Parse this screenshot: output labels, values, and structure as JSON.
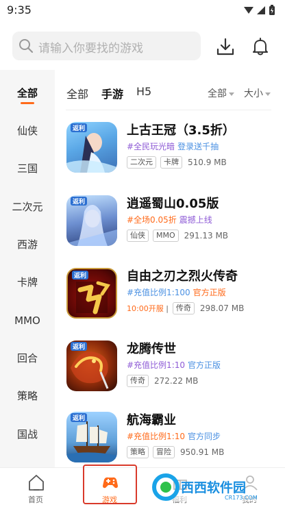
{
  "status_bar": {
    "time": "9:35"
  },
  "search": {
    "placeholder": "请输入你要找的游戏"
  },
  "sidebar": {
    "items": [
      {
        "label": "全部",
        "active": true
      },
      {
        "label": "仙侠"
      },
      {
        "label": "三国"
      },
      {
        "label": "二次元"
      },
      {
        "label": "西游"
      },
      {
        "label": "卡牌"
      },
      {
        "label": "MMO"
      },
      {
        "label": "回合"
      },
      {
        "label": "策略"
      },
      {
        "label": "国战"
      }
    ]
  },
  "tabs": {
    "items": [
      {
        "label": "全部"
      },
      {
        "label": "手游",
        "active": true
      },
      {
        "label": "H5"
      }
    ],
    "filter_all": "全部",
    "filter_size": "大小"
  },
  "badge_text": "返利",
  "games": [
    {
      "title": "上古王冠（3.5折）",
      "promo_a": "#全民玩光暗",
      "promo_b": "登录送千抽",
      "tags": [
        "二次元",
        "卡牌"
      ],
      "size": "510.9 MB"
    },
    {
      "title": "逍遥蜀山0.05版",
      "promo_a": "#全场0.05折",
      "promo_b": "震撼上线",
      "tags": [
        "仙侠",
        "MMO"
      ],
      "size": "291.13 MB"
    },
    {
      "title": "自由之刃之烈火传奇",
      "promo_a": "#充值比例1:100",
      "promo_b": "官方正版",
      "open_time": "10:00开服",
      "tags": [
        "传奇"
      ],
      "size": "298.07 MB"
    },
    {
      "title": "龙腾传世",
      "promo_a": "#充值比例1:10",
      "promo_b": "官方正版",
      "tags": [
        "传奇"
      ],
      "size": "272.22 MB"
    },
    {
      "title": "航海霸业",
      "promo_a": "#充值比例1:10",
      "promo_b": "官方同步",
      "tags": [
        "策略",
        "冒险"
      ],
      "size": "950.91 MB"
    }
  ],
  "bottom_nav": {
    "items": [
      {
        "label": "首页"
      },
      {
        "label": "游戏",
        "active": true
      },
      {
        "label": "福利"
      },
      {
        "label": "我的"
      }
    ]
  },
  "watermark": {
    "text": "西西软件园",
    "sub": "CR173.COM"
  },
  "colors": {
    "accent": "#ff6a1a",
    "purple": "#8e5bd6",
    "blue": "#4a90e2",
    "highlight": "#d9392a"
  }
}
